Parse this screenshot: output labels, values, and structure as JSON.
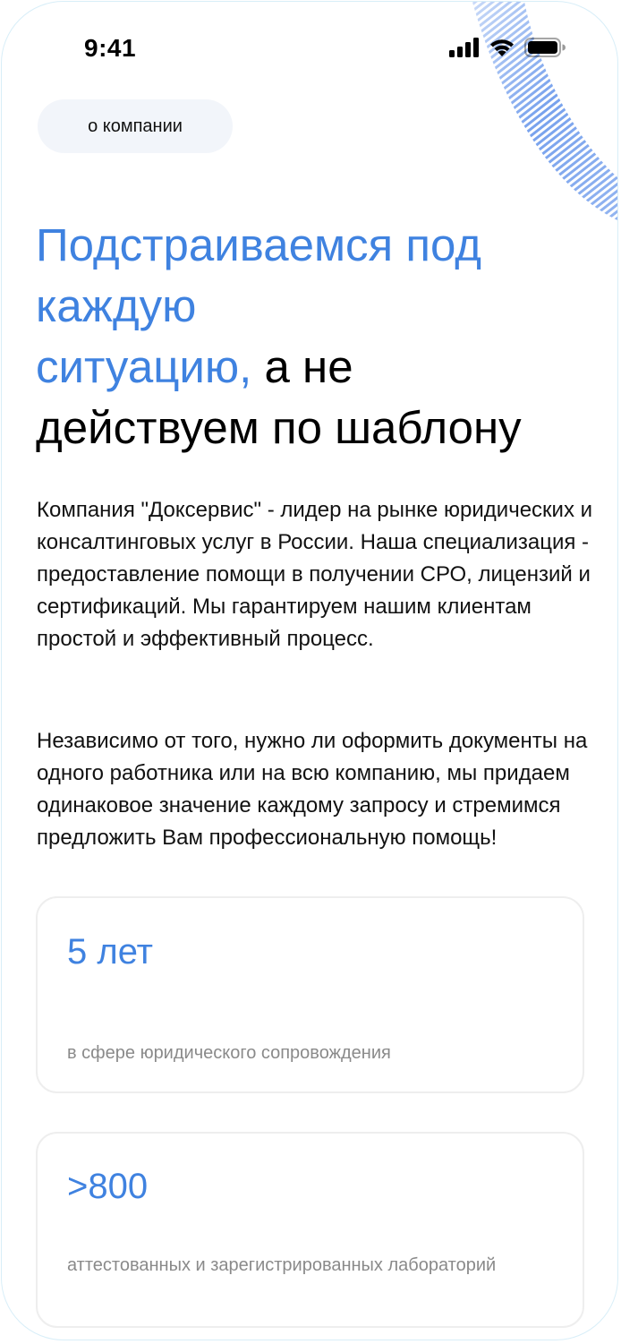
{
  "status_bar": {
    "time": "9:41",
    "icons": [
      "cellular-signal-icon",
      "wifi-icon",
      "battery-icon"
    ]
  },
  "chip": {
    "label": "о компании"
  },
  "headline": {
    "accent_part_1": "Подстраиваемся под каждую",
    "accent_part_2": "ситуацию,",
    "plain_part_1": " а не",
    "plain_part_2": "действуем по шаблону"
  },
  "intro": {
    "paragraph_1": "Компания \"Доксервис\" - лидер на рынке юридических и консалтинговых услуг в России. Наша специализация - предоставление помощи в получении СРО, лицензий и сертификаций. Мы гарантируем нашим клиентам простой и эффективный процесс.",
    "paragraph_2": "Независимо от того, нужно ли оформить документы на одного работника или на всю компанию, мы придаем одинаковое значение каждому запросу и стремимся предложить Вам профессиональную помощь!"
  },
  "stats": [
    {
      "value": "5 лет",
      "label": "в сфере юридического сопровождения"
    },
    {
      "value": ">800",
      "label": "аттестованных и зарегистрированных лабораторий"
    }
  ],
  "colors": {
    "accent": "#3f82e0",
    "text": "#111111",
    "muted": "#8a8a8a",
    "chip_background": "#f2f5fa",
    "card_border": "#eeeeee",
    "frame_border": "#d8eef8"
  }
}
